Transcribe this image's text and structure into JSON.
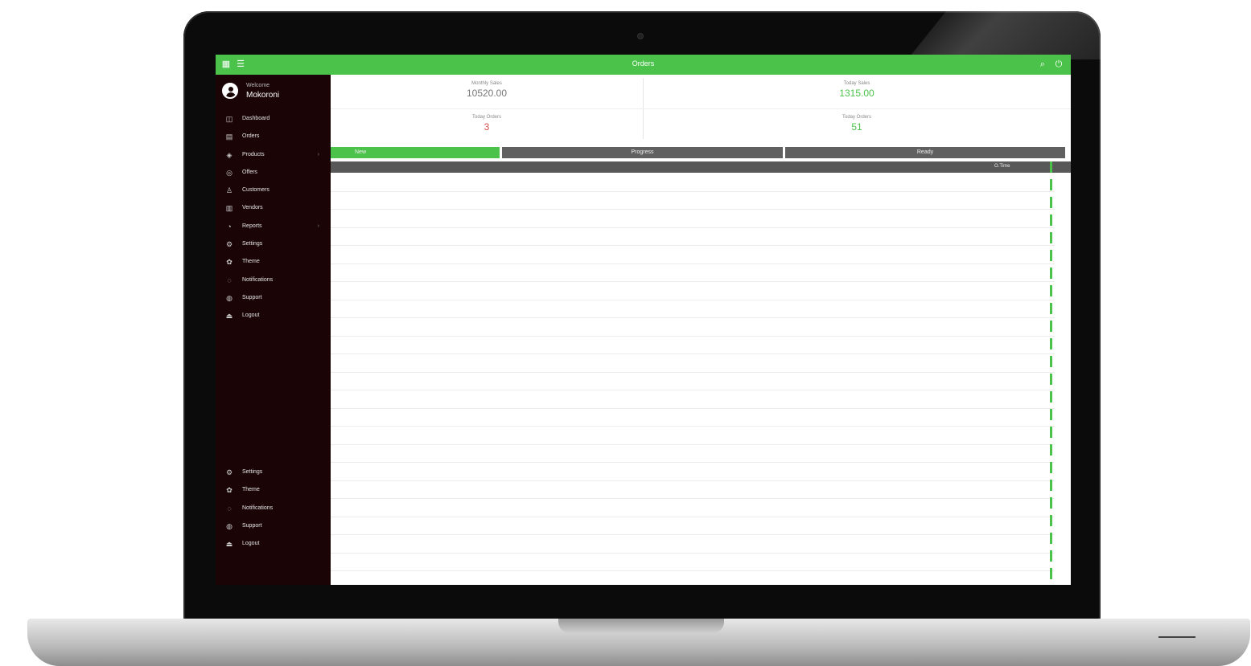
{
  "app": {
    "title": "Orders"
  },
  "topbar": {
    "left_icons": [
      "grid-icon",
      "menu-icon"
    ],
    "right_icons": [
      "search-icon",
      "power-icon"
    ]
  },
  "profile": {
    "welcome": "Welcome",
    "username": "Mokoroni"
  },
  "sidebar": {
    "items": [
      {
        "label": "Dashboard",
        "icon": "dashboard-icon"
      },
      {
        "label": "Orders",
        "icon": "orders-icon"
      },
      {
        "label": "Products",
        "icon": "products-icon",
        "arrow": "›"
      },
      {
        "label": "Offers",
        "icon": "offers-icon"
      },
      {
        "label": "Customers",
        "icon": "customers-icon"
      },
      {
        "label": "Vendors",
        "icon": "vendors-icon"
      },
      {
        "label": "Reports",
        "icon": "reports-icon",
        "arrow": "›"
      },
      {
        "label": "Settings",
        "icon": "settings-icon"
      },
      {
        "label": "Theme",
        "icon": "theme-icon"
      },
      {
        "label": "Notifications",
        "icon": "bell-icon"
      },
      {
        "label": "Support",
        "icon": "support-icon"
      },
      {
        "label": "Logout",
        "icon": "logout-icon"
      }
    ],
    "bottom_items": [
      {
        "label": "Settings",
        "icon": "settings-icon"
      },
      {
        "label": "Theme",
        "icon": "theme-icon"
      },
      {
        "label": "Notifications",
        "icon": "bell-icon"
      },
      {
        "label": "Support",
        "icon": "support-icon"
      },
      {
        "label": "Logout",
        "icon": "logout-icon"
      }
    ]
  },
  "stats": {
    "monthly_sales": {
      "label": "Monthly Sales",
      "value": "10520.00"
    },
    "today_sales": {
      "label": "Today Sales",
      "value": "1315.00"
    },
    "today_orders_left": {
      "label": "Today Orders",
      "value": "3"
    },
    "today_orders_right": {
      "label": "Today Orders",
      "value": "51"
    }
  },
  "tabs": [
    {
      "label": "New",
      "active": true
    },
    {
      "label": "Progress",
      "active": false
    },
    {
      "label": "Ready",
      "active": false
    }
  ],
  "table": {
    "header": "O.Time"
  },
  "colors": {
    "accent": "#4bc34b",
    "sidebar": "#1a0406",
    "value_gray": "#777777",
    "value_green": "#4bc34b",
    "value_red": "#d9534f"
  }
}
